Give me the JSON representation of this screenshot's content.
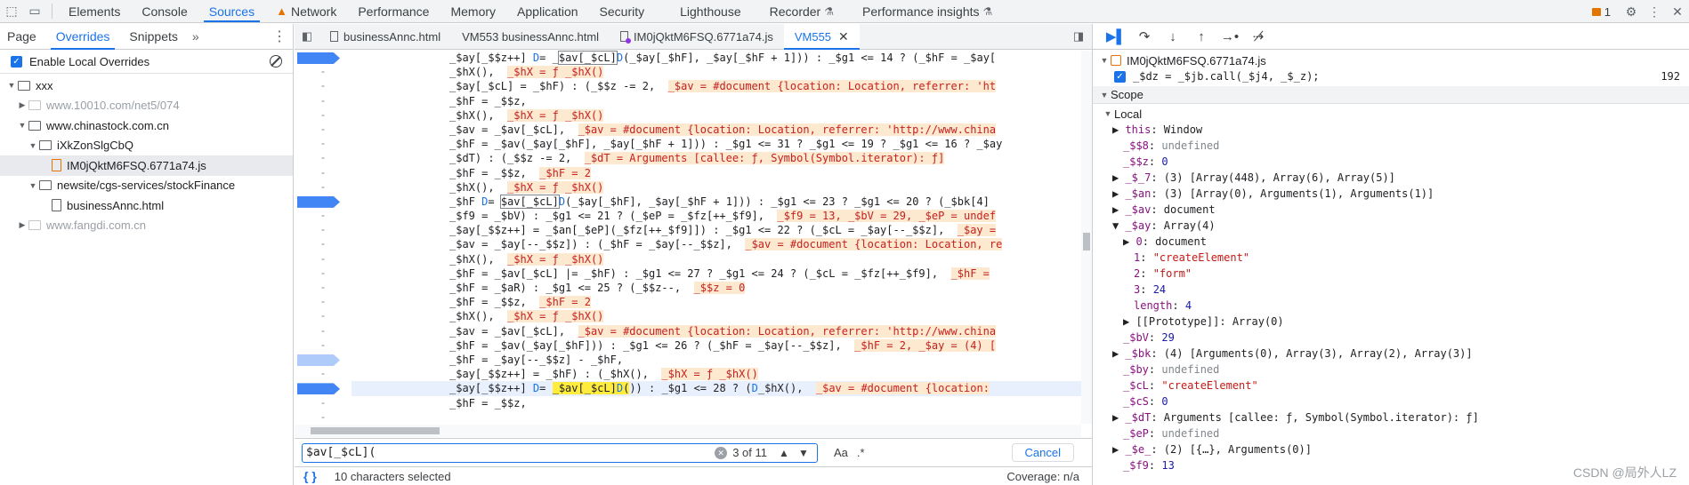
{
  "toolbar": {
    "tabs": [
      "Elements",
      "Console",
      "Sources",
      "Network",
      "Performance",
      "Memory",
      "Application",
      "Security",
      "Lighthouse",
      "Recorder",
      "Performance insights"
    ],
    "issues_count": "1"
  },
  "navigator": {
    "tabs": [
      "Page",
      "Overrides",
      "Snippets"
    ],
    "enable_overrides_label": "Enable Local Overrides",
    "tree": [
      "xxx",
      "www.10010.com/net5/074",
      "www.chinastock.com.cn",
      "iXkZonSlgCbQ",
      "IM0jQktM6FSQ.6771a74.js",
      "newsite/cgs-services/stockFinance",
      "businessAnnc.html",
      "www.fangdi.com.cn"
    ]
  },
  "editor": {
    "tabs": [
      "businessAnnc.html",
      "VM553 businessAnnc.html",
      "IM0jQktM6FSQ.6771a74.js",
      "VM555"
    ],
    "gutter": [
      "-",
      "-",
      "-",
      "-",
      "-",
      "-",
      "-",
      "-",
      "-",
      "-",
      "-",
      "-",
      "-",
      "-",
      "-",
      "-",
      "-",
      "-",
      "-",
      "-",
      "-",
      "-",
      "-",
      "-",
      "-",
      "-"
    ]
  },
  "search": {
    "query": "$av[_$cL](",
    "count": "3 of 11",
    "case_label": "Aa",
    "regex_label": ".*",
    "cancel_label": "Cancel"
  },
  "status": {
    "selection": "10 characters selected",
    "coverage": "Coverage: n/a"
  },
  "debugger": {
    "callstack_file": "IM0jQktM6FSQ.6771a74.js",
    "callstack_code": "_$dz = _$jb.call(_$j4, _$_z);",
    "callstack_line": "192",
    "scope_label": "Scope",
    "local_label": "Local",
    "watermark": "CSDN @局外人LZ"
  }
}
